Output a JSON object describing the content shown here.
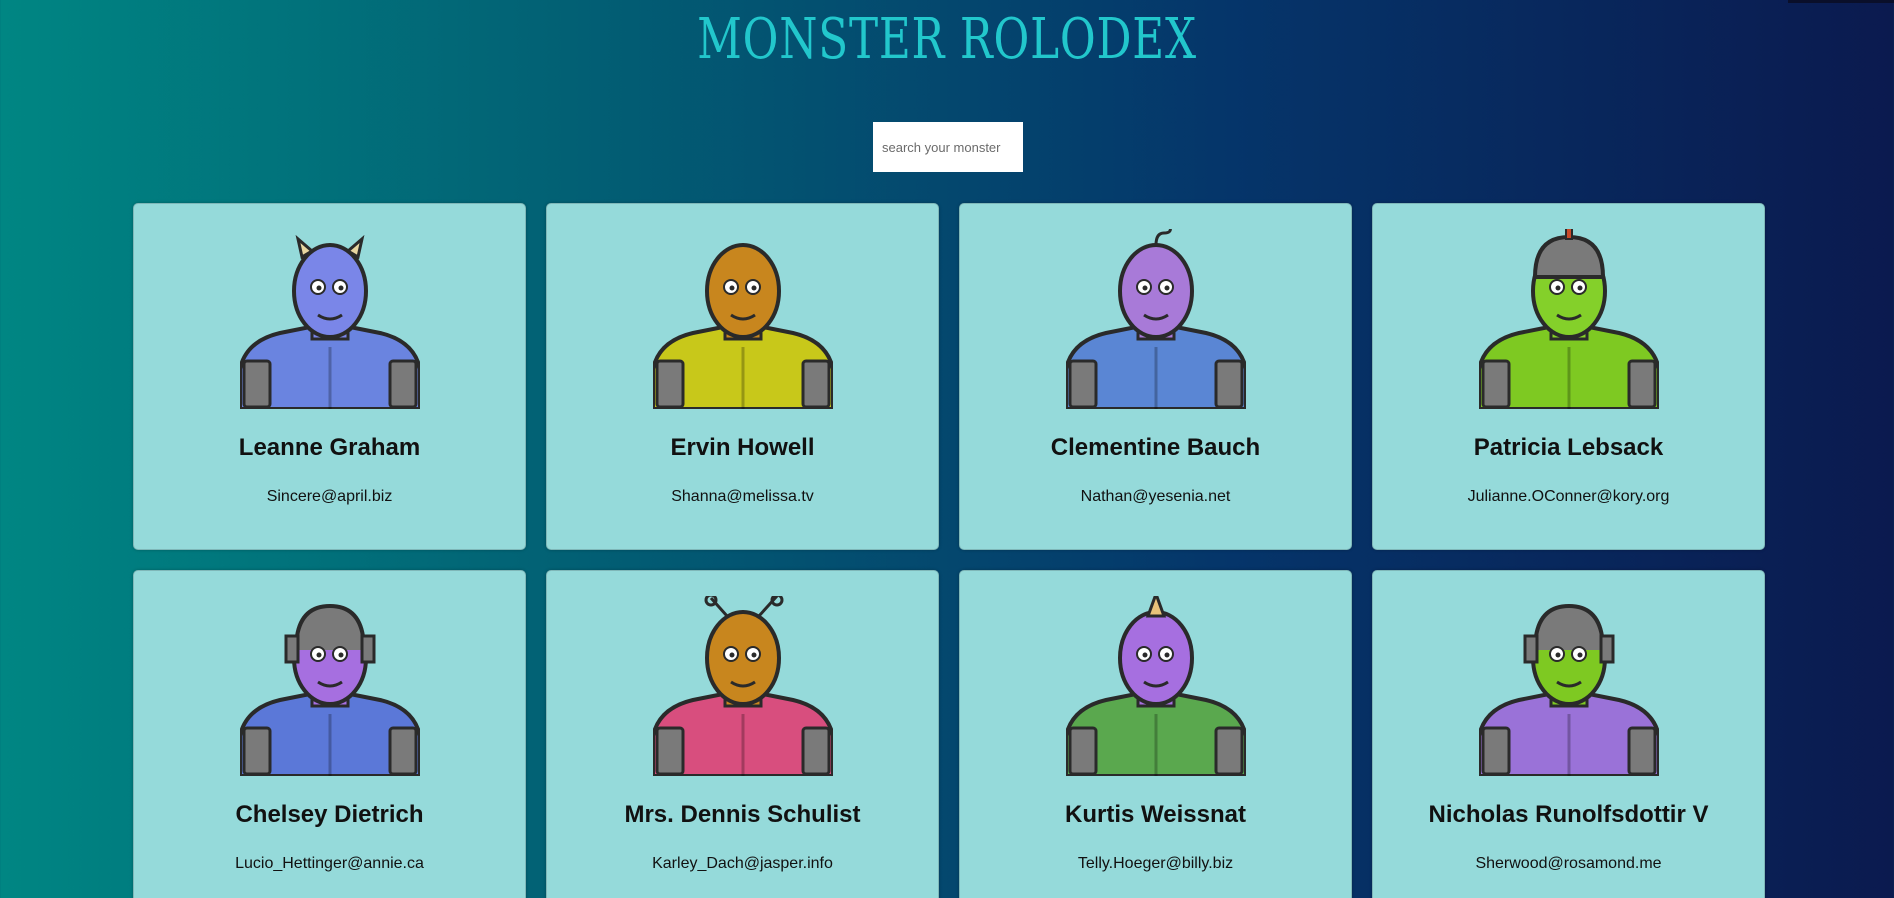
{
  "header": {
    "title": "MONSTER ROLODEX"
  },
  "search": {
    "placeholder": "search your monster",
    "value": ""
  },
  "monsters": [
    {
      "name": "Leanne Graham",
      "email": "Sincere@april.biz",
      "body_color": "#6a84e0",
      "head_color": "#7a86e8",
      "antenna": "horns"
    },
    {
      "name": "Ervin Howell",
      "email": "Shanna@melissa.tv",
      "body_color": "#c8c81a",
      "head_color": "#c8861e",
      "antenna": "none"
    },
    {
      "name": "Clementine Bauch",
      "email": "Nathan@yesenia.net",
      "body_color": "#5a86d4",
      "head_color": "#a87ad8",
      "antenna": "curl"
    },
    {
      "name": "Patricia Lebsack",
      "email": "Julianne.OConner@kory.org",
      "body_color": "#7ec922",
      "head_color": "#84d02a",
      "antenna": "helmet"
    },
    {
      "name": "Chelsey Dietrich",
      "email": "Lucio_Hettinger@annie.ca",
      "body_color": "#5b78d8",
      "head_color": "#a66fe0",
      "antenna": "robot"
    },
    {
      "name": "Mrs. Dennis Schulist",
      "email": "Karley_Dach@jasper.info",
      "body_color": "#d84e7e",
      "head_color": "#c8861e",
      "antenna": "bug"
    },
    {
      "name": "Kurtis Weissnat",
      "email": "Telly.Hoeger@billy.biz",
      "body_color": "#5aa84e",
      "head_color": "#a66fe0",
      "antenna": "horn"
    },
    {
      "name": "Nicholas Runolfsdottir V",
      "email": "Sherwood@rosamond.me",
      "body_color": "#9a72d8",
      "head_color": "#7ec922",
      "antenna": "robot"
    }
  ]
}
